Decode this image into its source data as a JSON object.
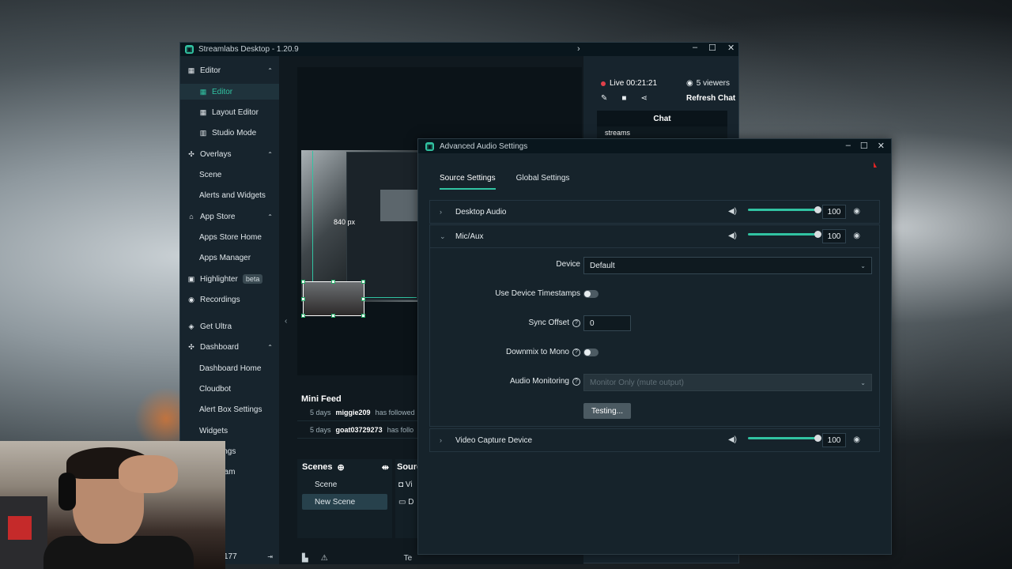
{
  "app": {
    "title": "Streamlabs Desktop - 1.20.9",
    "window_controls": [
      "–",
      "☐",
      "✕"
    ]
  },
  "sidebar": {
    "sections": [
      {
        "label": "Editor",
        "caret": "⌃"
      },
      {
        "label": "Overlays",
        "caret": "⌃"
      },
      {
        "label": "App Store",
        "caret": "⌃"
      },
      {
        "label": "Dashboard",
        "caret": "⌃"
      }
    ],
    "items": {
      "editor_editor": "Editor",
      "layout_editor": "Layout Editor",
      "studio_mode": "Studio Mode",
      "scene": "Scene",
      "alerts_widgets": "Alerts and Widgets",
      "apps_store_home": "Apps Store Home",
      "apps_manager": "Apps Manager",
      "highlighter": "Highlighter",
      "highlighter_badge": "beta",
      "recordings": "Recordings",
      "get_ultra": "Get Ultra",
      "dashboard_home": "Dashboard Home",
      "cloudbot": "Cloudbot",
      "alert_box": "Alert Box Settings",
      "widgets": "Widgets",
      "partial1": "ings",
      "partial2": "eam",
      "footer_num": "177"
    }
  },
  "editor": {
    "px_label": "840 px",
    "mini_feed": {
      "title": "Mini Feed",
      "rows": [
        {
          "time": "5 days",
          "user": "miggie209",
          "action": "has followed"
        },
        {
          "time": "5 days",
          "user": "goat03729273",
          "action": "has follo"
        }
      ]
    },
    "scenes": {
      "title": "Scenes",
      "items": [
        "Scene",
        "New Scene"
      ],
      "selected": "New Scene"
    },
    "sources_title": "Sourc",
    "sources_items": [
      "Vi",
      "D"
    ],
    "bottom_partial": "Te"
  },
  "live_panel": {
    "status": "Live 00:21:21",
    "viewers": "5 viewers",
    "refresh": "Refresh Chat",
    "chat_title": "Chat",
    "chat_message": "streams"
  },
  "dialog": {
    "title": "Advanced Audio Settings",
    "tabs": [
      "Source Settings",
      "Global Settings"
    ],
    "active_tab": "Source Settings",
    "sources": [
      {
        "name": "Desktop Audio",
        "volume": "100",
        "level": 1.0
      },
      {
        "name": "Mic/Aux",
        "volume": "100",
        "level": 1.0
      },
      {
        "name": "Video Capture Device",
        "volume": "100",
        "level": 1.0
      }
    ],
    "mic_settings": {
      "device_label": "Device",
      "device_value": "Default",
      "timestamps_label": "Use Device Timestamps",
      "sync_label": "Sync Offset",
      "sync_value": "0",
      "downmix_label": "Downmix to Mono",
      "monitoring_label": "Audio Monitoring",
      "monitoring_value": "Monitor Only (mute output)",
      "testing_button": "Testing..."
    }
  },
  "colors": {
    "accent": "#31c3a2",
    "panel": "#17242d",
    "live_dot": "#e0404a"
  }
}
